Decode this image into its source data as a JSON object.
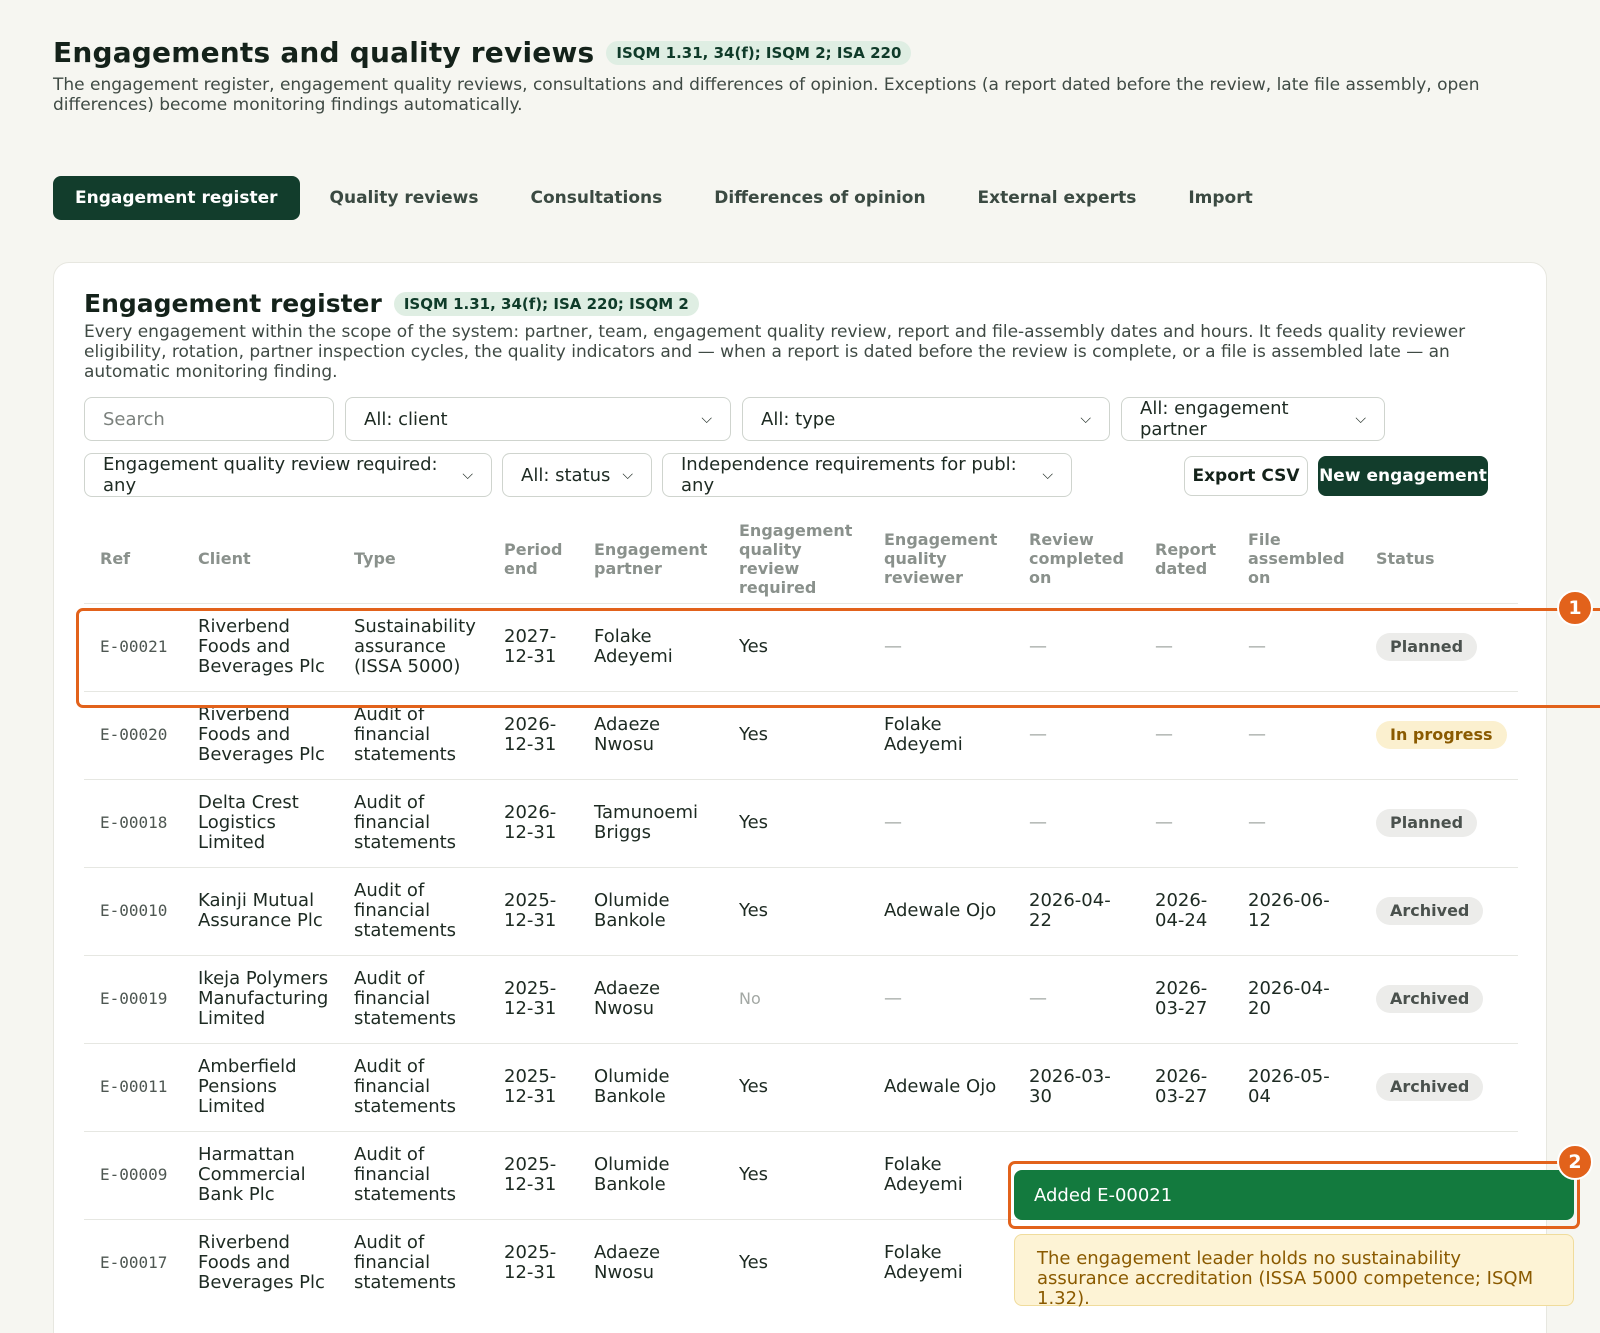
{
  "page": {
    "title": "Engagements and quality reviews",
    "tag": "ISQM 1.31, 34(f); ISQM 2; ISA 220",
    "intro": "The engagement register, engagement quality reviews, consultations and differences of opinion. Exceptions (a report dated before the review, late file assembly, open differences) become monitoring findings automatically."
  },
  "tabs": [
    {
      "label": "Engagement register",
      "active": true
    },
    {
      "label": "Quality reviews"
    },
    {
      "label": "Consultations"
    },
    {
      "label": "Differences of opinion"
    },
    {
      "label": "External experts"
    },
    {
      "label": "Import"
    }
  ],
  "register": {
    "title": "Engagement register",
    "tag": "ISQM 1.31, 34(f); ISA 220; ISQM 2",
    "description": "Every engagement within the scope of the system: partner, team, engagement quality review, report and file-assembly dates and hours. It feeds quality reviewer eligibility, rotation, partner inspection cycles, the quality indicators and — when a report is dated before the review is complete, or a file is assembled late — an automatic monitoring finding."
  },
  "filters": {
    "search_placeholder": "Search",
    "client": "All: client",
    "type": "All: type",
    "partner": "All: engagement partner",
    "eqr_required": "Engagement quality review required: any",
    "status": "All: status",
    "independence": "Independence requirements for publ: any",
    "export_label": "Export CSV",
    "new_label": "New engagement"
  },
  "columns": [
    "Ref",
    "Client",
    "Type",
    "Period end",
    "Engagement partner",
    "Engagement quality review required",
    "Engagement quality reviewer",
    "Review completed on",
    "Report dated",
    "File assembled on",
    "Status"
  ],
  "rows": [
    {
      "ref": "E-00021",
      "client": "Riverbend Foods and Beverages Plc",
      "type": "Sustainability assurance (ISSA 5000)",
      "period": "2027-12-31",
      "partner": "Folake Adeyemi",
      "eqr": "Yes",
      "reviewer": "—",
      "review": "—",
      "report": "—",
      "file": "—",
      "status": "Planned",
      "status_kind": "planned"
    },
    {
      "ref": "E-00020",
      "client": "Riverbend Foods and Beverages Plc",
      "type": "Audit of financial statements",
      "period": "2026-12-31",
      "partner": "Adaeze Nwosu",
      "eqr": "Yes",
      "reviewer": "Folake Adeyemi",
      "review": "—",
      "report": "—",
      "file": "—",
      "status": "In progress",
      "status_kind": "progress"
    },
    {
      "ref": "E-00018",
      "client": "Delta Crest Logistics Limited",
      "type": "Audit of financial statements",
      "period": "2026-12-31",
      "partner": "Tamunoemi Briggs",
      "eqr": "Yes",
      "reviewer": "—",
      "review": "—",
      "report": "—",
      "file": "—",
      "status": "Planned",
      "status_kind": "planned"
    },
    {
      "ref": "E-00010",
      "client": "Kainji Mutual Assurance Plc",
      "type": "Audit of financial statements",
      "period": "2025-12-31",
      "partner": "Olumide Bankole",
      "eqr": "Yes",
      "reviewer": "Adewale Ojo",
      "review": "2026-04-22",
      "report": "2026-04-24",
      "file": "2026-06-12",
      "status": "Archived",
      "status_kind": "archived"
    },
    {
      "ref": "E-00019",
      "client": "Ikeja Polymers Manufacturing Limited",
      "type": "Audit of financial statements",
      "period": "2025-12-31",
      "partner": "Adaeze Nwosu",
      "eqr": "No",
      "reviewer": "—",
      "review": "—",
      "report": "2026-03-27",
      "file": "2026-04-20",
      "status": "Archived",
      "status_kind": "archived"
    },
    {
      "ref": "E-00011",
      "client": "Amberfield Pensions Limited",
      "type": "Audit of financial statements",
      "period": "2025-12-31",
      "partner": "Olumide Bankole",
      "eqr": "Yes",
      "reviewer": "Adewale Ojo",
      "review": "2026-03-30",
      "report": "2026-03-27",
      "file": "2026-05-04",
      "status": "Archived",
      "status_kind": "archived"
    },
    {
      "ref": "E-00009",
      "client": "Harmattan Commercial Bank Plc",
      "type": "Audit of financial statements",
      "period": "2025-12-31",
      "partner": "Olumide Bankole",
      "eqr": "Yes",
      "reviewer": "Folake Adeyemi",
      "review": "",
      "report": "",
      "file": "",
      "status": "",
      "status_kind": ""
    },
    {
      "ref": "E-00017",
      "client": "Riverbend Foods and Beverages Plc",
      "type": "Audit of financial statements",
      "period": "2025-12-31",
      "partner": "Adaeze Nwosu",
      "eqr": "Yes",
      "reviewer": "Folake Adeyemi",
      "review": "",
      "report": "",
      "file": "",
      "status": "",
      "status_kind": ""
    }
  ],
  "markers": [
    "1",
    "2"
  ],
  "toast": "Added E-00021",
  "warning": "The engagement leader holds no sustainability assurance accreditation (ISSA 5000 competence; ISQM 1.32).",
  "colors": {
    "brand": "#123d2c",
    "highlight": "#e2621b",
    "toast": "#137a3e"
  }
}
